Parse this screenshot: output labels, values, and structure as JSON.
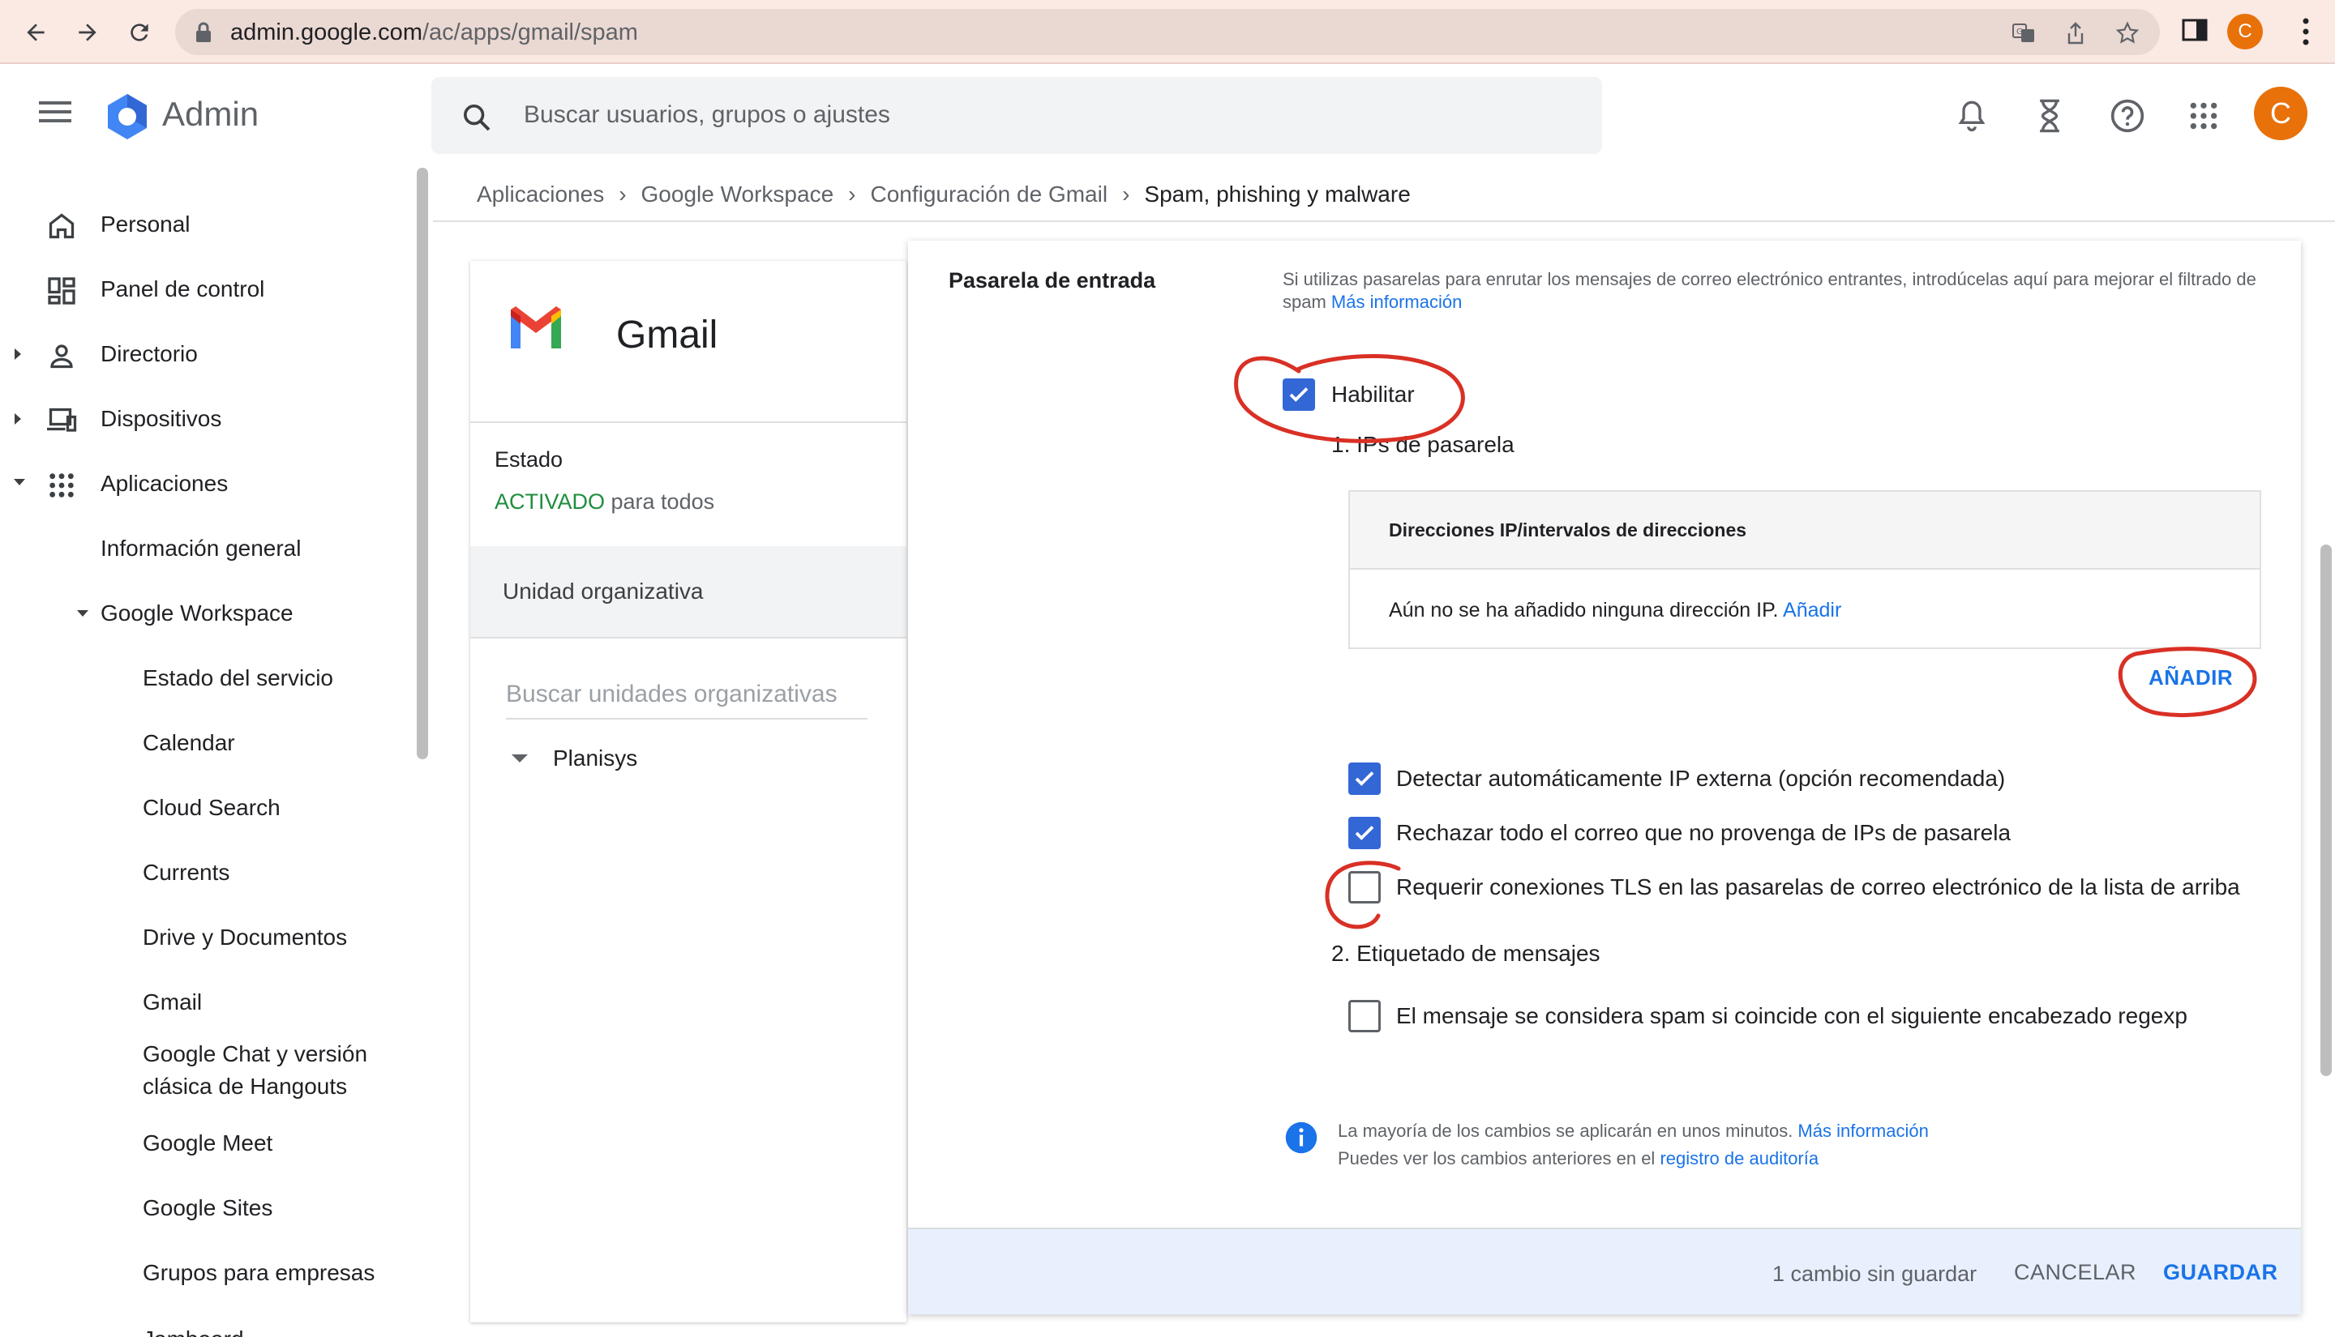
{
  "browser": {
    "url_host": "admin.google.com",
    "url_path": "/ac/apps/gmail/spam",
    "profile_initial": "C"
  },
  "header": {
    "title": "Admin",
    "search_placeholder": "Buscar usuarios, grupos o ajustes",
    "profile_initial": "C"
  },
  "sidebar": {
    "items": [
      {
        "label": "Personal",
        "icon": "home-icon"
      },
      {
        "label": "Panel de control",
        "icon": "dashboard-icon"
      },
      {
        "label": "Directorio",
        "icon": "person-icon"
      },
      {
        "label": "Dispositivos",
        "icon": "devices-icon"
      },
      {
        "label": "Aplicaciones",
        "icon": "apps-grid-icon"
      },
      {
        "label": "Información general"
      },
      {
        "label": "Google Workspace"
      },
      {
        "label": "Estado del servicio"
      },
      {
        "label": "Calendar"
      },
      {
        "label": "Cloud Search"
      },
      {
        "label": "Currents"
      },
      {
        "label": "Drive y Documentos"
      },
      {
        "label": "Gmail"
      },
      {
        "label": "Google Chat y versión"
      },
      {
        "label": "clásica de Hangouts"
      },
      {
        "label": "Google Meet"
      },
      {
        "label": "Google Sites"
      },
      {
        "label": "Grupos para empresas"
      },
      {
        "label": "Jamboard"
      }
    ]
  },
  "breadcrumb": {
    "items": [
      "Aplicaciones",
      "Google Workspace",
      "Configuración de Gmail"
    ],
    "current": "Spam, phishing y malware"
  },
  "left_card": {
    "app_name": "Gmail",
    "status_label": "Estado",
    "status_on": "ACTIVADO",
    "status_suffix": " para todos",
    "ou_header": "Unidad organizativa",
    "ou_search_placeholder": "Buscar unidades organizativas",
    "ou_root": "Planisys"
  },
  "panel": {
    "section_title": "Pasarela de entrada",
    "description": "Si utilizas pasarelas para enrutar los mensajes de correo electrónico entrantes, introdúcelas aquí para mejorar el filtrado de spam ",
    "description_link": "Más información",
    "enable_label": "Habilitar",
    "enable_checked": true,
    "gateway_ips_heading": "1. IPs de pasarela",
    "table_header": "Direcciones IP/intervalos de direcciones",
    "table_empty": "Aún no se ha añadido ninguna dirección IP. ",
    "table_empty_link": "Añadir",
    "add_button": "AÑADIR",
    "options": [
      {
        "label": "Detectar automáticamente IP externa (opción recomendada)",
        "checked": true
      },
      {
        "label": "Rechazar todo el correo que no provenga de IPs de pasarela",
        "checked": true
      },
      {
        "label": "Requerir conexiones TLS en las pasarelas de correo electrónico de la lista de arriba",
        "checked": false
      }
    ],
    "tagging_heading": "2. Etiquetado de mensajes",
    "tagging_option": {
      "label": "El mensaje se considera spam si coincide con el siguiente encabezado regexp",
      "checked": false
    },
    "info_line1": "La mayoría de los cambios se aplicarán en unos minutos. ",
    "info_line1_link": "Más información",
    "info_line2": "Puedes ver los cambios anteriores en el ",
    "info_line2_link": "registro de auditoría"
  },
  "footer": {
    "unsaved": "1 cambio sin guardar",
    "cancel": "CANCELAR",
    "save": "GUARDAR"
  },
  "colors": {
    "accent": "#1a73e8",
    "checkbox": "#3367d6",
    "status_on": "#1e8e3e",
    "annotation": "#d93025"
  }
}
